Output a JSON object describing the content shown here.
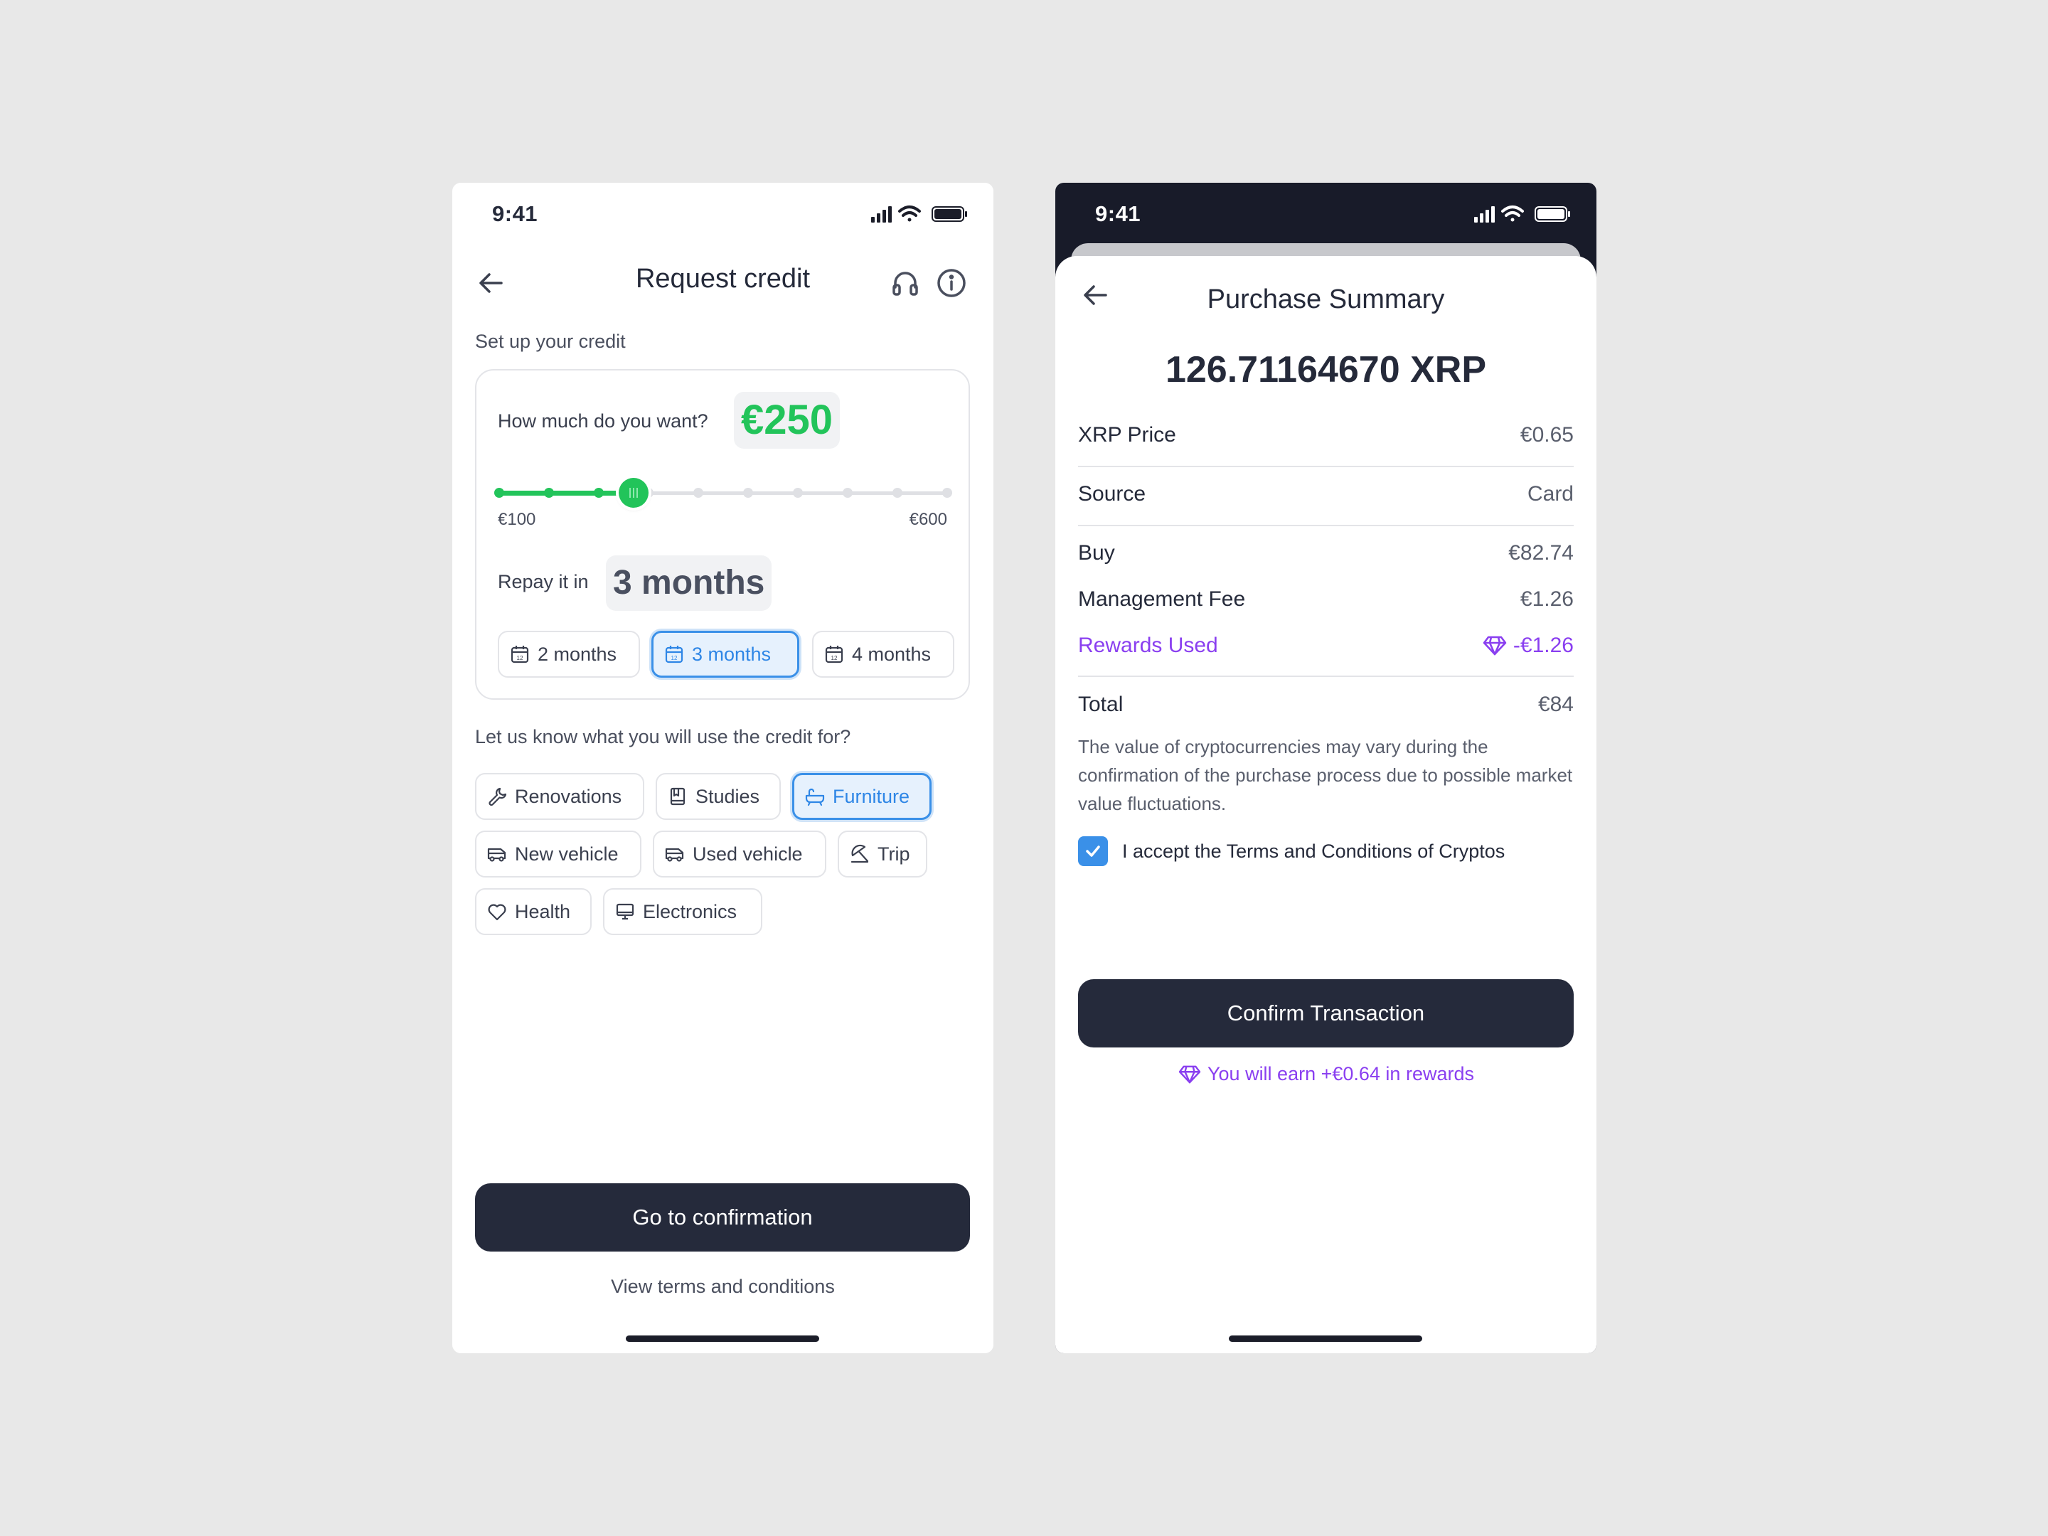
{
  "status": {
    "time": "9:41"
  },
  "left": {
    "title": "Request credit",
    "section_setup": "Set up your credit",
    "amount_question": "How much do you want?",
    "amount_value": "€250",
    "slider": {
      "min_label": "€100",
      "max_label": "€600",
      "value_fraction": 0.3,
      "steps": 10
    },
    "repay_label": "Repay it in",
    "repay_value": "3 months",
    "month_options": [
      {
        "label": "2 months",
        "selected": false
      },
      {
        "label": "3 months",
        "selected": true
      },
      {
        "label": "4 months",
        "selected": false
      }
    ],
    "use_question": "Let us know what you will use the credit for?",
    "use_options": [
      {
        "label": "Renovations",
        "icon": "wrench-icon",
        "selected": false
      },
      {
        "label": "Studies",
        "icon": "book-icon",
        "selected": false
      },
      {
        "label": "Furniture",
        "icon": "bathtub-icon",
        "selected": true
      },
      {
        "label": "New vehicle",
        "icon": "van-icon",
        "selected": false
      },
      {
        "label": "Used vehicle",
        "icon": "van-icon",
        "selected": false
      },
      {
        "label": "Trip",
        "icon": "umbrella-icon",
        "selected": false
      },
      {
        "label": "Health",
        "icon": "heart-icon",
        "selected": false
      },
      {
        "label": "Electronics",
        "icon": "monitor-icon",
        "selected": false
      }
    ],
    "cta_label": "Go to confirmation",
    "terms_link": "View terms and conditions"
  },
  "right": {
    "title": "Purchase Summary",
    "crypto_amount": "126.71164670 XRP",
    "rows": {
      "price": {
        "label": "XRP Price",
        "value": "€0.65"
      },
      "source": {
        "label": "Source",
        "value": "Card"
      },
      "buy": {
        "label": "Buy",
        "value": "€82.74"
      },
      "fee": {
        "label": "Management Fee",
        "value": "€1.26"
      },
      "rewards": {
        "label": "Rewards Used",
        "value": "-€1.26"
      },
      "total": {
        "label": "Total",
        "value": "€84"
      }
    },
    "disclaimer": "The value of cryptocurrencies may vary during the confirmation of the purchase process due to possible market value fluctuations.",
    "accept_label": "I accept the Terms and Conditions of Cryptos",
    "accept_checked": true,
    "cta_label": "Confirm Transaction",
    "earn_text": "You will earn +€0.64 in rewards"
  },
  "colors": {
    "accent_green": "#22c45a",
    "accent_blue": "#3a90e8",
    "reward_purple": "#8a3ff0",
    "button_dark": "#252a3b",
    "background": "#e8e8e8"
  }
}
